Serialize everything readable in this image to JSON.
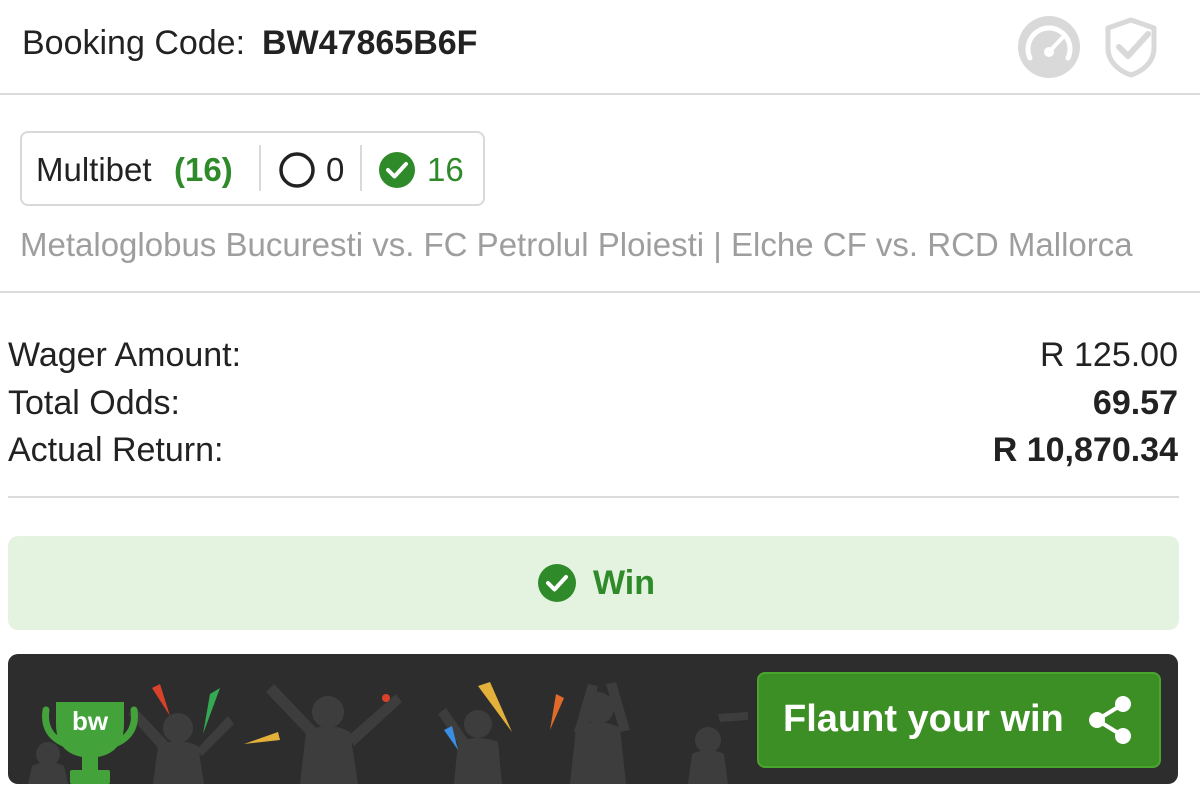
{
  "header": {
    "booking_label": "Booking Code:",
    "booking_code": "BW47865B6F",
    "icons": [
      "speedometer-icon",
      "shield-check-icon"
    ]
  },
  "summary": {
    "multibet_label": "Multibet",
    "multibet_count": "(16)",
    "pending_count": "0",
    "won_count": "16",
    "events": "Metaloglobus Bucuresti vs. FC Petrolul Ploiesti | Elche CF vs. RCD Mallorca"
  },
  "details": {
    "wager_label": "Wager Amount:",
    "wager_value": "R 125.00",
    "odds_label": "Total Odds:",
    "odds_value": "69.57",
    "return_label": "Actual Return:",
    "return_value": "R 10,870.34"
  },
  "result": {
    "label": "Win"
  },
  "promo": {
    "logo_text": "bw",
    "button_label": "Flaunt your win",
    "icons": [
      "trophy-icon",
      "share-icon"
    ]
  },
  "colors": {
    "accent_green": "#2f8a2a",
    "button_green": "#3c8f24",
    "win_bg": "#e4f3e0",
    "promo_bg": "#2d2d2d"
  }
}
